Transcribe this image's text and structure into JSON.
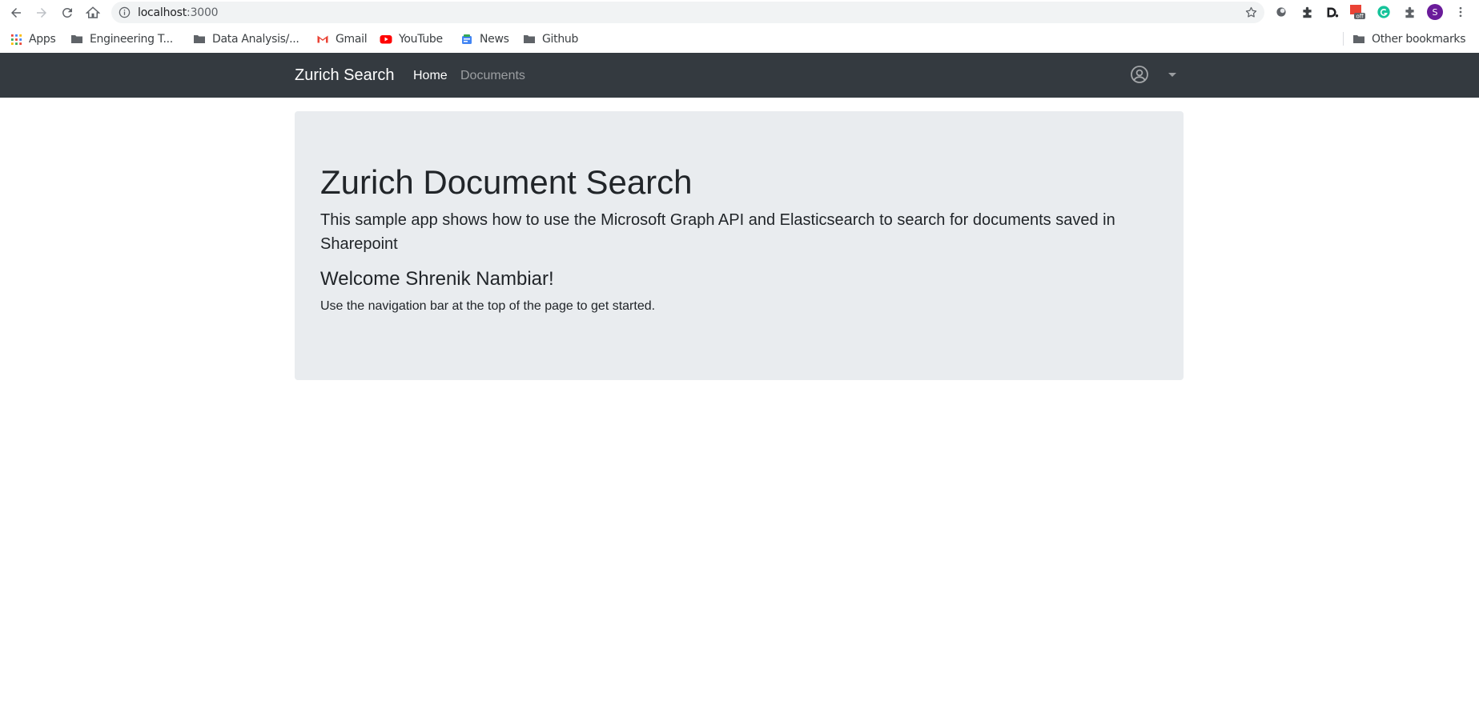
{
  "browser": {
    "url_host": "localhost",
    "url_port": ":3000",
    "icons": [
      "back-icon",
      "forward-icon",
      "reload-icon",
      "home-icon",
      "info-icon",
      "star-icon",
      "extensions-icon",
      "menu-icon"
    ],
    "profile_initial": "S",
    "extension_badge": "off"
  },
  "bookmarks": {
    "items": [
      {
        "label": "Apps",
        "icon": "apps-grid-icon"
      },
      {
        "label": "Engineering T...",
        "icon": "folder-icon"
      },
      {
        "label": "Data Analysis/...",
        "icon": "folder-icon"
      },
      {
        "label": "Gmail",
        "icon": "gmail-icon"
      },
      {
        "label": "YouTube",
        "icon": "youtube-icon"
      },
      {
        "label": "News",
        "icon": "news-icon"
      },
      {
        "label": "Github",
        "icon": "folder-icon"
      }
    ],
    "other": "Other bookmarks"
  },
  "navbar": {
    "brand": "Zurich Search",
    "links": [
      {
        "label": "Home",
        "active": true
      },
      {
        "label": "Documents",
        "active": false
      }
    ],
    "background": "#343a40"
  },
  "jumbotron": {
    "title": "Zurich Document Search",
    "lead": "This sample app shows how to use the Microsoft Graph API and Elasticsearch to search for documents saved in Sharepoint",
    "welcome": "Welcome Shrenik Nambiar!",
    "hint": "Use the navigation bar at the top of the page to get started.",
    "background": "#e9ecef"
  }
}
